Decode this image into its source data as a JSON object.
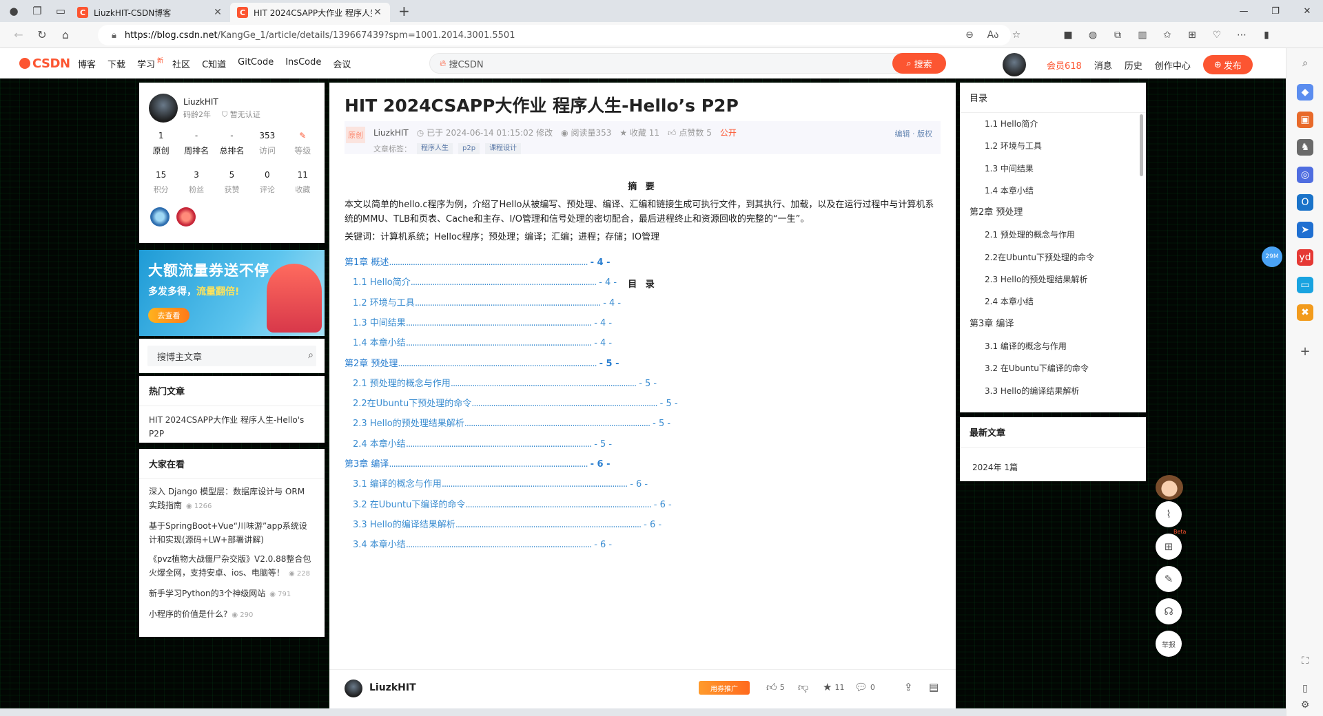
{
  "browser": {
    "tabs": [
      {
        "favicon": "C",
        "title": "LiuzkHIT-CSDN博客"
      },
      {
        "favicon": "C",
        "title": "HIT 2024CSAPP大作业 程序人生-Hello’s P2P"
      }
    ],
    "url_host": "https://blog.csdn.net",
    "url_path": "/KangGe_1/article/details/139667439?spm=1001.2014.3001.5501"
  },
  "csdn": {
    "logo": "CSDN",
    "nav": [
      "博客",
      "下载",
      "学习",
      "社区",
      "C知道",
      "GitCode",
      "InsCode",
      "会议"
    ],
    "nav_new": "新",
    "search_placeholder": "搜CSDN",
    "search_button": "搜索",
    "vip": "会员618",
    "messages": "消息",
    "history": "历史",
    "creator": "创作中心",
    "publish": "发布"
  },
  "profile": {
    "name": "LiuzkHIT",
    "age": "码龄2年",
    "cert": "暂无认证",
    "stats1": [
      {
        "v": "1",
        "l": "原创"
      },
      {
        "v": "-",
        "l": "周排名"
      },
      {
        "v": "-",
        "l": "总排名"
      },
      {
        "v": "353",
        "l": "访问"
      },
      {
        "v": "",
        "l": "等级"
      }
    ],
    "stats2": [
      {
        "v": "15",
        "l": "积分"
      },
      {
        "v": "3",
        "l": "粉丝"
      },
      {
        "v": "5",
        "l": "获赞"
      },
      {
        "v": "0",
        "l": "评论"
      },
      {
        "v": "11",
        "l": "收藏"
      }
    ]
  },
  "ad": {
    "title": "大额流量券送不停",
    "sub_a": "多发多得，",
    "sub_b": "流量翻倍!",
    "cta": "去查看"
  },
  "blog_search": {
    "placeholder": "搜博主文章"
  },
  "hot": {
    "title": "热门文章",
    "items": [
      "HIT 2024CSAPP大作业 程序人生-Hello's P2P"
    ]
  },
  "see": {
    "title": "大家在看",
    "items": [
      {
        "text": "深入 Django 模型层：数据库设计与 ORM 实践指南",
        "count": "1266"
      },
      {
        "text": "基于SpringBoot+Vue“川味游”app系统设计和实现(源码+LW+部署讲解)",
        "count": ""
      },
      {
        "text": "《pvz植物大战僵尸杂交版》V2.0.88整合包火爆全网，支持安卓、ios、电脑等！",
        "count": "228"
      },
      {
        "text": "新手学习Python的3个神级网站",
        "count": "791"
      },
      {
        "text": "小程序的价值是什么?",
        "count": "290"
      }
    ]
  },
  "article": {
    "title": "HIT 2024CSAPP大作业 程序人生-Hello’s P2P",
    "orig": "原创",
    "author": "LiuzkHIT",
    "date": "已于 2024-06-14 01:15:02 修改",
    "reads": "阅读量353",
    "favs": "收藏 11",
    "likes": "点赞数 5",
    "public": "公开",
    "edit": "编辑",
    "copyright": "版权",
    "tags_label": "文章标签：",
    "tags": [
      "程序人生",
      "p2p",
      "课程设计"
    ],
    "abstract_title": "摘 要",
    "abstract": "本文以简单的hello.c程序为例，介绍了Hello从被编写、预处理、编译、汇编和链接生成可执行文件，到其执行、加载，以及在运行过程中与计算机系统的MMU、TLB和页表、Cache和主存、I/O管理和信号处理的密切配合，最后进程终止和资源回收的完整的“一生”。",
    "keywords": "关键词：计算机系统；Helloc程序；预处理；编译；汇编；进程；存储；IO管理",
    "toc_title": "目 录",
    "toc": [
      {
        "t": "第1章 概述",
        "p": "- 4 -",
        "lvl": 1
      },
      {
        "t": "1.1 Hello简介",
        "p": "- 4 -",
        "lvl": 2
      },
      {
        "t": "1.2 环境与工具",
        "p": "- 4 -",
        "lvl": 2
      },
      {
        "t": "1.3 中间结果",
        "p": "- 4 -",
        "lvl": 2
      },
      {
        "t": "1.4 本章小结",
        "p": "- 4 -",
        "lvl": 2
      },
      {
        "t": "第2章 预处理",
        "p": "- 5 -",
        "lvl": 1
      },
      {
        "t": "2.1 预处理的概念与作用",
        "p": "- 5 -",
        "lvl": 2
      },
      {
        "t": "2.2在Ubuntu下预处理的命令",
        "p": "- 5 -",
        "lvl": 2
      },
      {
        "t": "2.3 Hello的预处理结果解析",
        "p": "- 5 -",
        "lvl": 2
      },
      {
        "t": "2.4 本章小结",
        "p": "- 5 -",
        "lvl": 2
      },
      {
        "t": "第3章 编译",
        "p": "- 6 -",
        "lvl": 1
      },
      {
        "t": "3.1 编译的概念与作用",
        "p": "- 6 -",
        "lvl": 2
      },
      {
        "t": "3.2 在Ubuntu下编译的命令",
        "p": "- 6 -",
        "lvl": 2
      },
      {
        "t": "3.3 Hello的编译结果解析",
        "p": "- 6 -",
        "lvl": 2
      },
      {
        "t": "3.4 本章小结",
        "p": "- 6 -",
        "lvl": 2
      }
    ]
  },
  "bottom": {
    "author": "LiuzkHIT",
    "promo": "用券推广",
    "likes": "5",
    "favs": "11",
    "comments": "0"
  },
  "side_toc": {
    "title": "目录",
    "items": [
      {
        "t": "1.1 Hello简介",
        "lvl": 2
      },
      {
        "t": "1.2 环境与工具",
        "lvl": 2
      },
      {
        "t": "1.3 中间结果",
        "lvl": 2
      },
      {
        "t": "1.4 本章小结",
        "lvl": 2
      },
      {
        "t": "第2章 预处理",
        "lvl": 1
      },
      {
        "t": "2.1 预处理的概念与作用",
        "lvl": 2
      },
      {
        "t": "2.2在Ubuntu下预处理的命令",
        "lvl": 2
      },
      {
        "t": "2.3 Hello的预处理结果解析",
        "lvl": 2
      },
      {
        "t": "2.4 本章小结",
        "lvl": 2
      },
      {
        "t": "第3章 编译",
        "lvl": 1
      },
      {
        "t": "3.1 编译的概念与作用",
        "lvl": 2
      },
      {
        "t": "3.2 在Ubuntu下编译的命令",
        "lvl": 2
      },
      {
        "t": "3.3 Hello的编译结果解析",
        "lvl": 2
      }
    ]
  },
  "latest": {
    "title": "最新文章",
    "year": "2024年  1篇"
  },
  "float": {
    "report": "举报",
    "beta": "Beta",
    "bubble": "29M"
  }
}
